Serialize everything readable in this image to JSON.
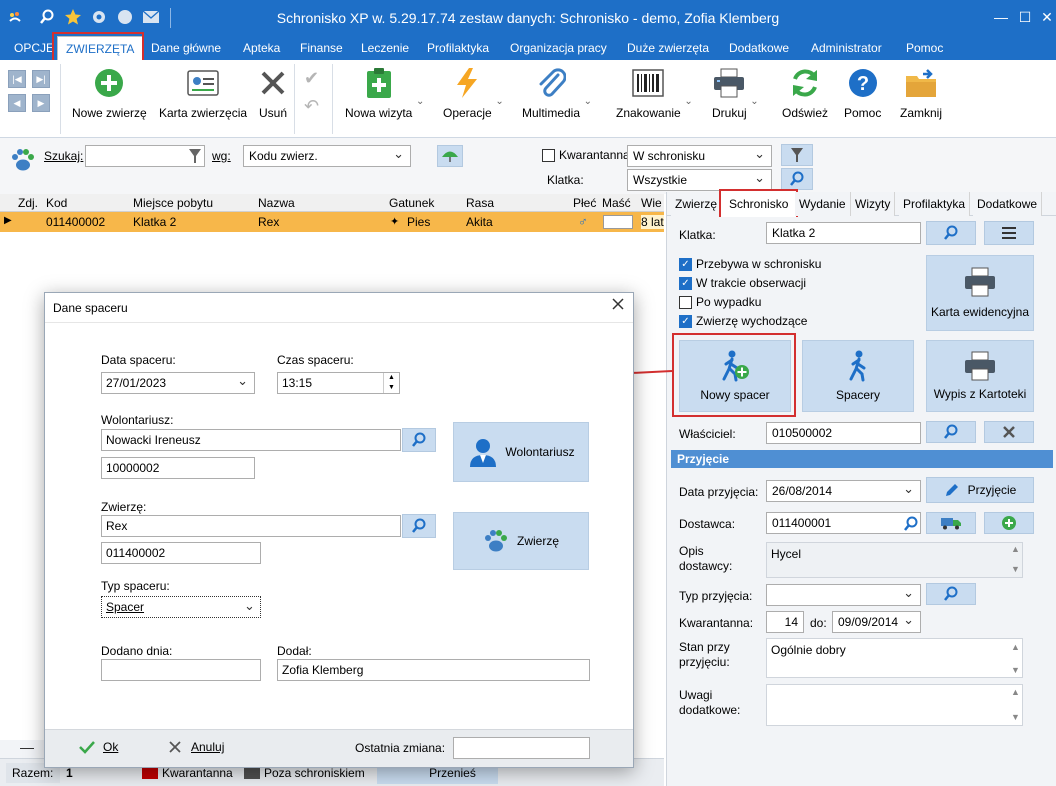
{
  "window": {
    "title": "Schronisko XP w. 5.29.17.74 zestaw danych: Schronisko - demo, Zofia Klemberg",
    "minimize": "—",
    "maximize": "☐",
    "close": "✕"
  },
  "menu": {
    "tabs": [
      "OPCJE",
      "ZWIERZĘTA",
      "Dane główne",
      "Apteka",
      "Finanse",
      "Leczenie",
      "Profilaktyka",
      "Organizacja pracy",
      "Duże zwierzęta",
      "Dodatkowe",
      "Administrator",
      "Pomoc"
    ],
    "active": "ZWIERZĘTA"
  },
  "ribbon": {
    "new_animal": "Nowe zwierzę",
    "animal_card": "Karta zwierzęcia",
    "delete": "Usuń",
    "new_visit": "Nowa wizyta",
    "operations": "Operacje",
    "multimedia": "Multimedia",
    "marking": "Znakowanie",
    "print": "Drukuj",
    "refresh": "Odśwież",
    "help": "Pomoc",
    "close": "Zamknij"
  },
  "search": {
    "search_label": "Szukaj:",
    "search_value": "",
    "by_label": "wg:",
    "by_value": "Kodu zwierz.",
    "quarantine_label": "Kwarantanna",
    "quarantine_checked": false,
    "location_value": "W schronisku",
    "cage_label": "Klatka:",
    "cage_value": "Wszystkie"
  },
  "grid": {
    "columns": [
      "Zdj.",
      "Kod",
      "Miejsce pobytu",
      "Nazwa",
      "Gatunek",
      "Rasa",
      "Płeć",
      "Maść",
      "Wie"
    ],
    "rows": [
      {
        "code": "011400002",
        "place": "Klatka 2",
        "name": "Rex",
        "species": "Pies",
        "breed": "Akita",
        "sex": "♂",
        "color": "",
        "age": "8 lat"
      }
    ]
  },
  "status": {
    "total_label": "Razem:",
    "total_value": "1",
    "legend_quarantine": "Kwarantanna",
    "legend_outside": "Poza schroniskiem",
    "move_button": "Przenieś",
    "quarantine_color": "#c00000",
    "outside_color": "#505050"
  },
  "right": {
    "tabs": [
      "Zwierzę",
      "Schronisko",
      "Wydanie",
      "Wizyty",
      "Profilaktyka",
      "Dodatkowe"
    ],
    "active_tab": "Schronisko",
    "cage_label": "Klatka:",
    "cage_value": "Klatka 2",
    "checks": [
      {
        "label": "Przebywa w schronisku",
        "checked": true
      },
      {
        "label": "W trakcie obserwacji",
        "checked": true
      },
      {
        "label": "Po wypadku",
        "checked": false
      },
      {
        "label": "Zwierzę wychodzące",
        "checked": true
      }
    ],
    "record_card": "Karta ewidencyjna",
    "new_walk": "Nowy spacer",
    "walks": "Spacery",
    "extract": "Wypis z Kartoteki",
    "owner_label": "Właściciel:",
    "owner_value": "010500002",
    "admission_header": "Przyjęcie",
    "admission_date_label": "Data przyjęcia:",
    "admission_date_value": "26/08/2014",
    "admission_button": "Przyjęcie",
    "supplier_label": "Dostawca:",
    "supplier_value": "011400001",
    "supplier_desc_label1": "Opis",
    "supplier_desc_label2": "dostawcy:",
    "supplier_desc_value": "Hycel",
    "admission_type_label": "Typ przyjęcia:",
    "admission_type_value": "",
    "quarantine_label": "Kwarantanna:",
    "quarantine_days": "14",
    "quarantine_to_label": "do:",
    "quarantine_to_value": "09/09/2014",
    "condition_label1": "Stan przy",
    "condition_label2": "przyjęciu:",
    "condition_value": "Ogólnie dobry",
    "notes_label1": "Uwagi",
    "notes_label2": "dodatkowe:",
    "notes_value": ""
  },
  "dialog": {
    "title": "Dane spaceru",
    "date_label": "Data spaceru:",
    "date_value": "27/01/2023",
    "time_label": "Czas spaceru:",
    "time_value": "13:15",
    "volunteer_label": "Wolontariusz:",
    "volunteer_name": "Nowacki Ireneusz",
    "volunteer_code": "10000002",
    "volunteer_button": "Wolontariusz",
    "animal_label": "Zwierzę:",
    "animal_name": "Rex",
    "animal_code": "011400002",
    "animal_button": "Zwierzę",
    "walk_type_label": "Typ spaceru:",
    "walk_type_value": "Spacer",
    "added_on_label": "Dodano dnia:",
    "added_on_value": "",
    "added_by_label": "Dodał:",
    "added_by_value": "Zofia Klemberg",
    "ok": "Ok",
    "cancel": "Anuluj",
    "last_change_label": "Ostatnia zmiana:",
    "last_change_value": ""
  },
  "colors": {
    "accent": "#1e6fc7",
    "selected_row": "#f7b74a",
    "highlight": "#d32f2f",
    "button_bg": "#c9dcf0"
  }
}
